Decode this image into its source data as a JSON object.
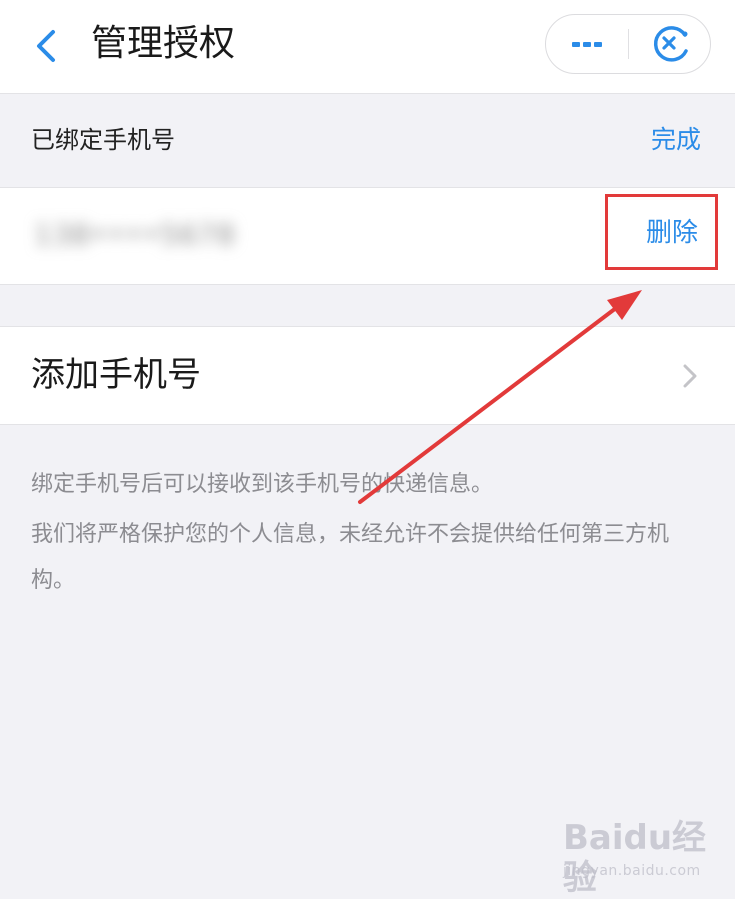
{
  "navbar": {
    "title": "管理授权",
    "back_icon": "chevron-left-icon",
    "more_icon": "more-dots-icon",
    "close_icon": "close-circle-icon",
    "accent_color": "#2b8ce8"
  },
  "bound_section": {
    "title": "已绑定手机号",
    "done_label": "完成"
  },
  "phone_row": {
    "phone_number": "138••••5678",
    "delete_label": "删除",
    "highlight_color": "#e23a3a"
  },
  "add_row": {
    "label": "添加手机号",
    "chevron_icon": "chevron-right-icon"
  },
  "info": {
    "line1": "绑定手机号后可以接收到该手机号的快递信息。",
    "line2": "我们将严格保护您的个人信息，未经允许不会提供给任何第三方机构。"
  },
  "watermark": {
    "brand": "Baidu经验",
    "url": "jingyan.baidu.com"
  }
}
